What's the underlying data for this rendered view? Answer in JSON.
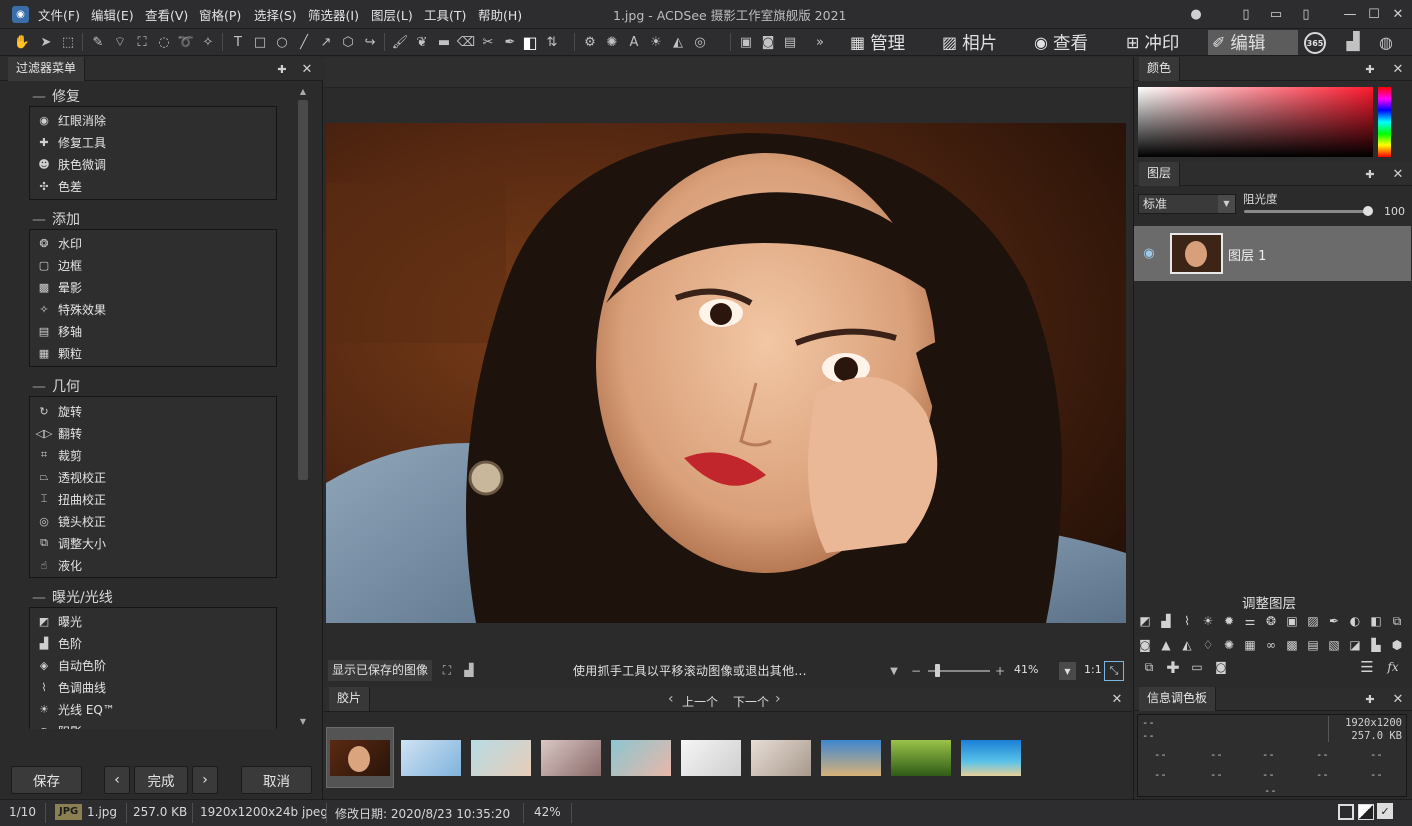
{
  "app": {
    "title": "1.jpg - ACDSee 摄影工作室旗舰版 2021"
  },
  "menu": [
    "文件(F)",
    "编辑(E)",
    "查看(V)",
    "窗格(P)",
    "选择(S)",
    "筛选器(I)",
    "图层(L)",
    "工具(T)",
    "帮助(H)"
  ],
  "modes": [
    {
      "label": "管理",
      "icon": "grid-icon"
    },
    {
      "label": "相片",
      "icon": "photos-icon"
    },
    {
      "label": "查看",
      "icon": "eye-icon"
    },
    {
      "label": "冲印",
      "icon": "develop-icon"
    },
    {
      "label": "编辑",
      "icon": "edit-icon",
      "active": true
    }
  ],
  "badge_365": "365",
  "filter_panel": {
    "title": "过滤器菜单",
    "groups": [
      {
        "title": "修复",
        "items": [
          "红眼消除",
          "修复工具",
          "肤色微调",
          "色差"
        ]
      },
      {
        "title": "添加",
        "items": [
          "水印",
          "边框",
          "晕影",
          "特殊效果",
          "移轴",
          "颗粒"
        ]
      },
      {
        "title": "几何",
        "items": [
          "旋转",
          "翻转",
          "裁剪",
          "透视校正",
          "扭曲校正",
          "镜头校正",
          "调整大小",
          "液化"
        ]
      },
      {
        "title": "曝光/光线",
        "items": [
          "曝光",
          "色阶",
          "自动色阶",
          "色调曲线",
          "光线 EQ™",
          "阴影"
        ]
      }
    ],
    "buttons": {
      "save": "保存",
      "done": "完成",
      "cancel": "取消"
    }
  },
  "viewer": {
    "show_saved": "显示已保存的图像",
    "hint": "使用抓手工具以平移滚动图像或退出其他...",
    "zoom": "41%",
    "ratio": "1:1"
  },
  "filmstrip": {
    "title": "胶片",
    "prev": "上一个",
    "next": "下一个",
    "count": 10
  },
  "color_panel": {
    "title": "颜色"
  },
  "layers_panel": {
    "title": "图层",
    "blend_mode": "标准",
    "opacity_label": "阻光度",
    "opacity_value": "100",
    "layer_name": "图层 1",
    "adjust_title": "调整图层"
  },
  "info_panel": {
    "title": "信息调色板",
    "dims": "1920x1200",
    "size": "257.0 KB",
    "dash": "--"
  },
  "status": {
    "index": "1/10",
    "format": "JPG",
    "filename": "1.jpg",
    "filesize": "257.0 KB",
    "dims": "1920x1200x24b jpeg",
    "modified": "修改日期: 2020/8/23 10:35:20",
    "zoom": "42%"
  },
  "colors": {
    "accent": "#5c5c5c",
    "panel": "#2b2b2b",
    "layer_selected": "#6b6b6b"
  }
}
